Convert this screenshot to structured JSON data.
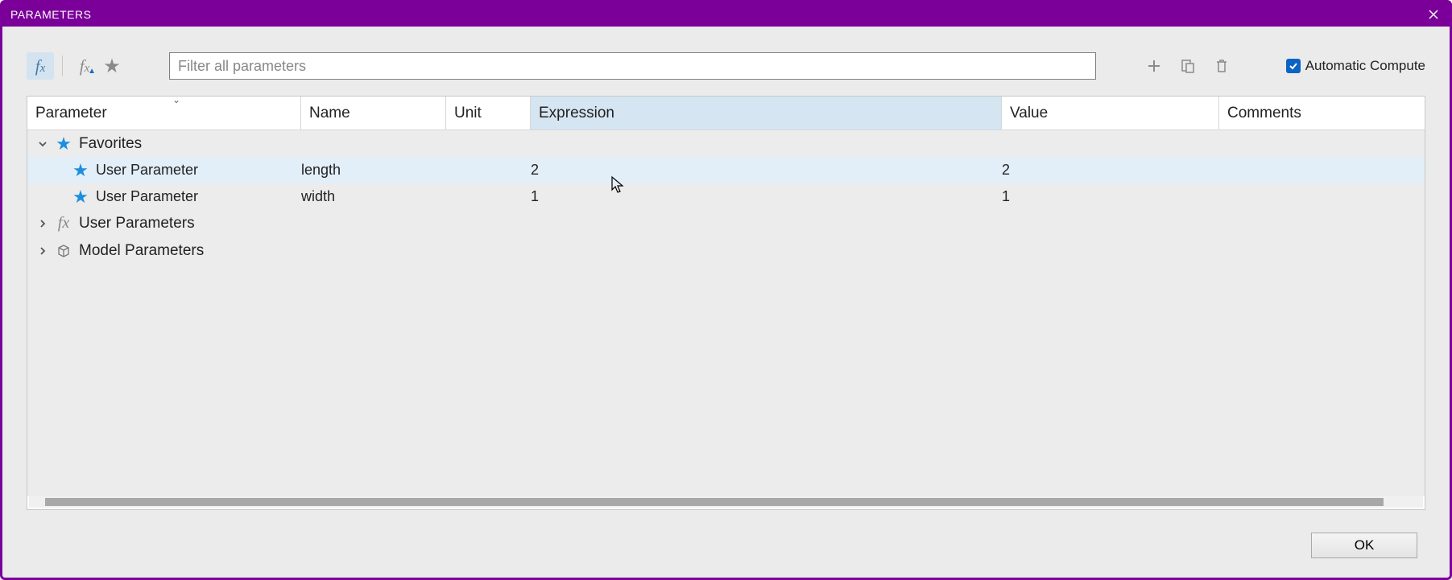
{
  "window": {
    "title": "PARAMETERS"
  },
  "toolbar": {
    "filter_placeholder": "Filter all parameters"
  },
  "autocompute": {
    "label": "Automatic Compute",
    "checked": true
  },
  "columns": {
    "param": "Parameter",
    "name": "Name",
    "unit": "Unit",
    "expr": "Expression",
    "value": "Value",
    "comments": "Comments"
  },
  "groups": {
    "favorites": {
      "label": "Favorites",
      "expanded": true
    },
    "user": {
      "label": "User Parameters",
      "expanded": false
    },
    "model": {
      "label": "Model Parameters",
      "expanded": false
    }
  },
  "rows": [
    {
      "type": "User Parameter",
      "name": "length",
      "unit": "",
      "expr": "2",
      "value": "2",
      "comments": ""
    },
    {
      "type": "User Parameter",
      "name": "width",
      "unit": "",
      "expr": "1",
      "value": "1",
      "comments": ""
    }
  ],
  "footer": {
    "ok": "OK"
  }
}
